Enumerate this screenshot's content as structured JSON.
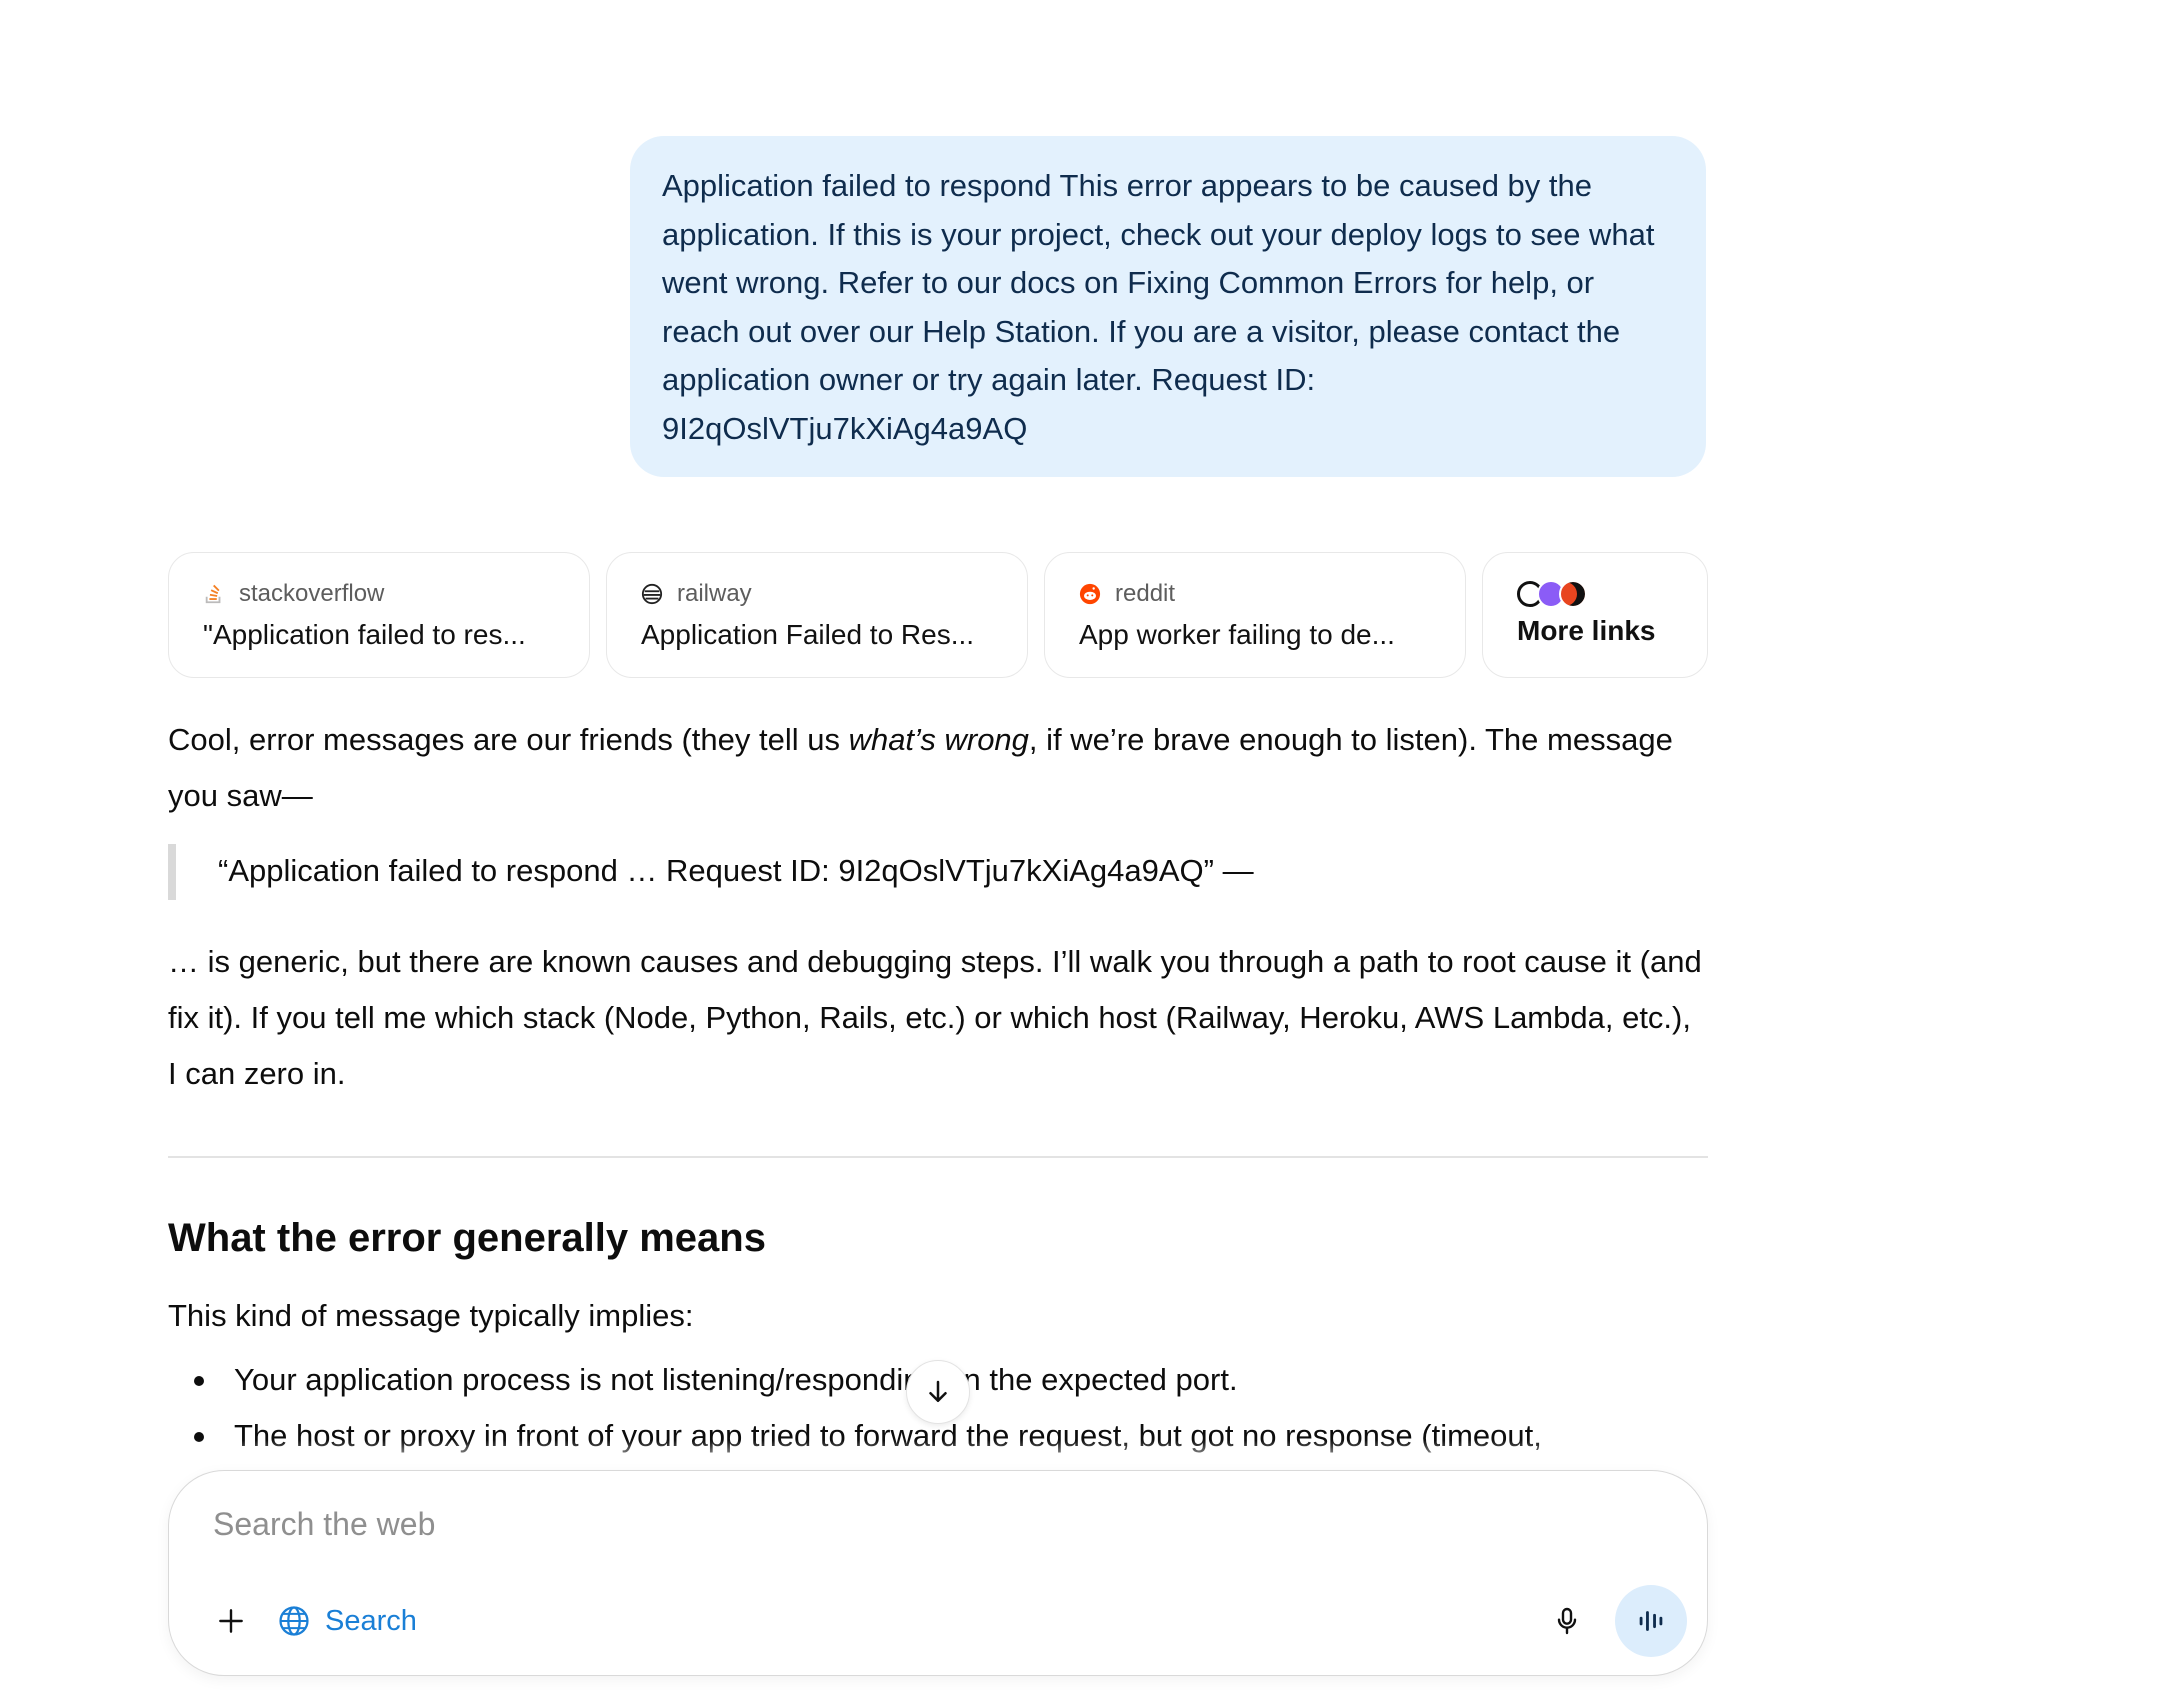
{
  "user_message": {
    "text": "Application failed to respond This error appears to be caused by the application. If this is your project, check out your deploy logs to see what went wrong. Refer to our docs on Fixing Common Errors for help, or reach out over our Help Station. If you are a visitor, please contact the application owner or try again later. Request ID: 9I2qOslVTju7kXiAg4a9AQ"
  },
  "sources": [
    {
      "site": "stackoverflow",
      "title": "\"Application failed to res...",
      "icon": "stackoverflow-icon"
    },
    {
      "site": "railway",
      "title": "Application Failed to Res...",
      "icon": "railway-icon"
    },
    {
      "site": "reddit",
      "title": "App worker failing to de...",
      "icon": "reddit-icon"
    }
  ],
  "more_links": {
    "label": "More links",
    "icons": [
      "github-icon",
      "purple-site-icon",
      "orange-site-icon"
    ]
  },
  "answer": {
    "p1_a": "Cool, error messages are our friends (they tell us ",
    "p1_em": "what’s wrong",
    "p1_b": ", if we’re brave enough to listen). The message you saw—",
    "quote": "“Application failed to respond … Request ID: 9I2qOslVTju7kXiAg4a9AQ” —",
    "p2": "… is generic, but there are known causes and debugging steps. I’ll walk you through a path to root cause it (and fix it). If you tell me which stack (Node, Python, Rails, etc.) or which host (Railway, Heroku, AWS Lambda, etc.), I can zero in.",
    "heading": "What the error generally means",
    "intro": "This kind of message typically implies:",
    "bullets": [
      "Your application process is not listening/responding on the expected port.",
      "The host or proxy in front of your app tried to forward the request, but got no response (timeout,"
    ]
  },
  "composer": {
    "placeholder": "Search the web",
    "search_label": "Search"
  },
  "colors": {
    "bubble_bg": "#e3f1fd",
    "accent": "#1a7fd6",
    "voice_bg": "#dcedfc"
  }
}
